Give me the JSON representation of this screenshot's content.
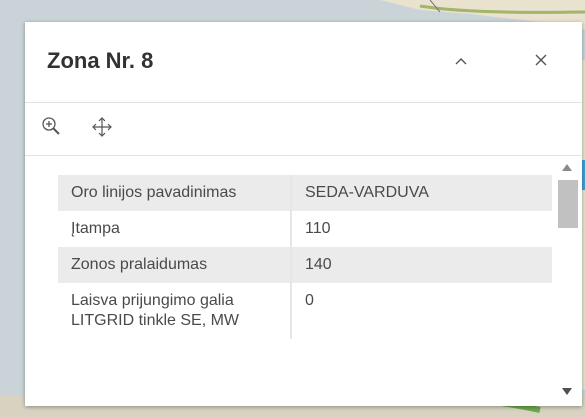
{
  "popup": {
    "title": "Zona Nr. 8",
    "collapse_icon": "chevron-up-icon",
    "close_icon": "close-icon"
  },
  "toolbar": {
    "tools": [
      {
        "icon": "zoom-in-icon"
      },
      {
        "icon": "pan-move-icon"
      }
    ]
  },
  "attributes": [
    {
      "label": "Oro linijos pavadinimas",
      "value": "SEDA-VARDUVA"
    },
    {
      "label": "Įtampa",
      "value": "110"
    },
    {
      "label": "Zonos pralaidumas",
      "value": "140"
    },
    {
      "label": "Laisva prijungimo galia LITGRID tinkle SE, MW",
      "value": "0"
    }
  ],
  "colors": {
    "title": "#323232",
    "row_alt": "#ebebeb",
    "text": "#4a4a4a"
  }
}
